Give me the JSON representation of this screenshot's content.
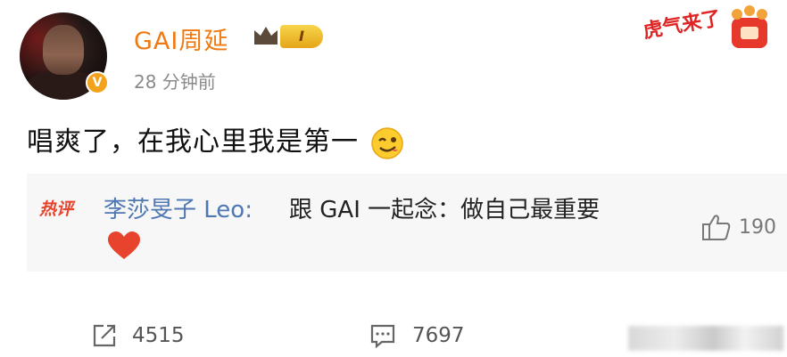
{
  "post": {
    "username": "GAI周延",
    "level": "I",
    "timestamp": "28 分钟前",
    "text": "唱爽了，在我心里我是第一",
    "sticker_text": "虎气来了"
  },
  "hot_comment": {
    "tag": "热评",
    "author": "李莎旻子 Leo:",
    "text": "跟 GAI 一起念：做自己最重要",
    "like_count": "190"
  },
  "actions": {
    "repost_count": "4515",
    "comment_count": "7697"
  },
  "icons": [
    "verified-badge-icon",
    "crown-icon",
    "wink-emoji-icon",
    "heart-icon",
    "thumbs-up-icon",
    "share-icon",
    "comment-icon"
  ],
  "colors": {
    "username": "#f07a12",
    "hot_tag": "#e8432d",
    "comment_author": "#4f78b3",
    "heart": "#e8432d"
  }
}
